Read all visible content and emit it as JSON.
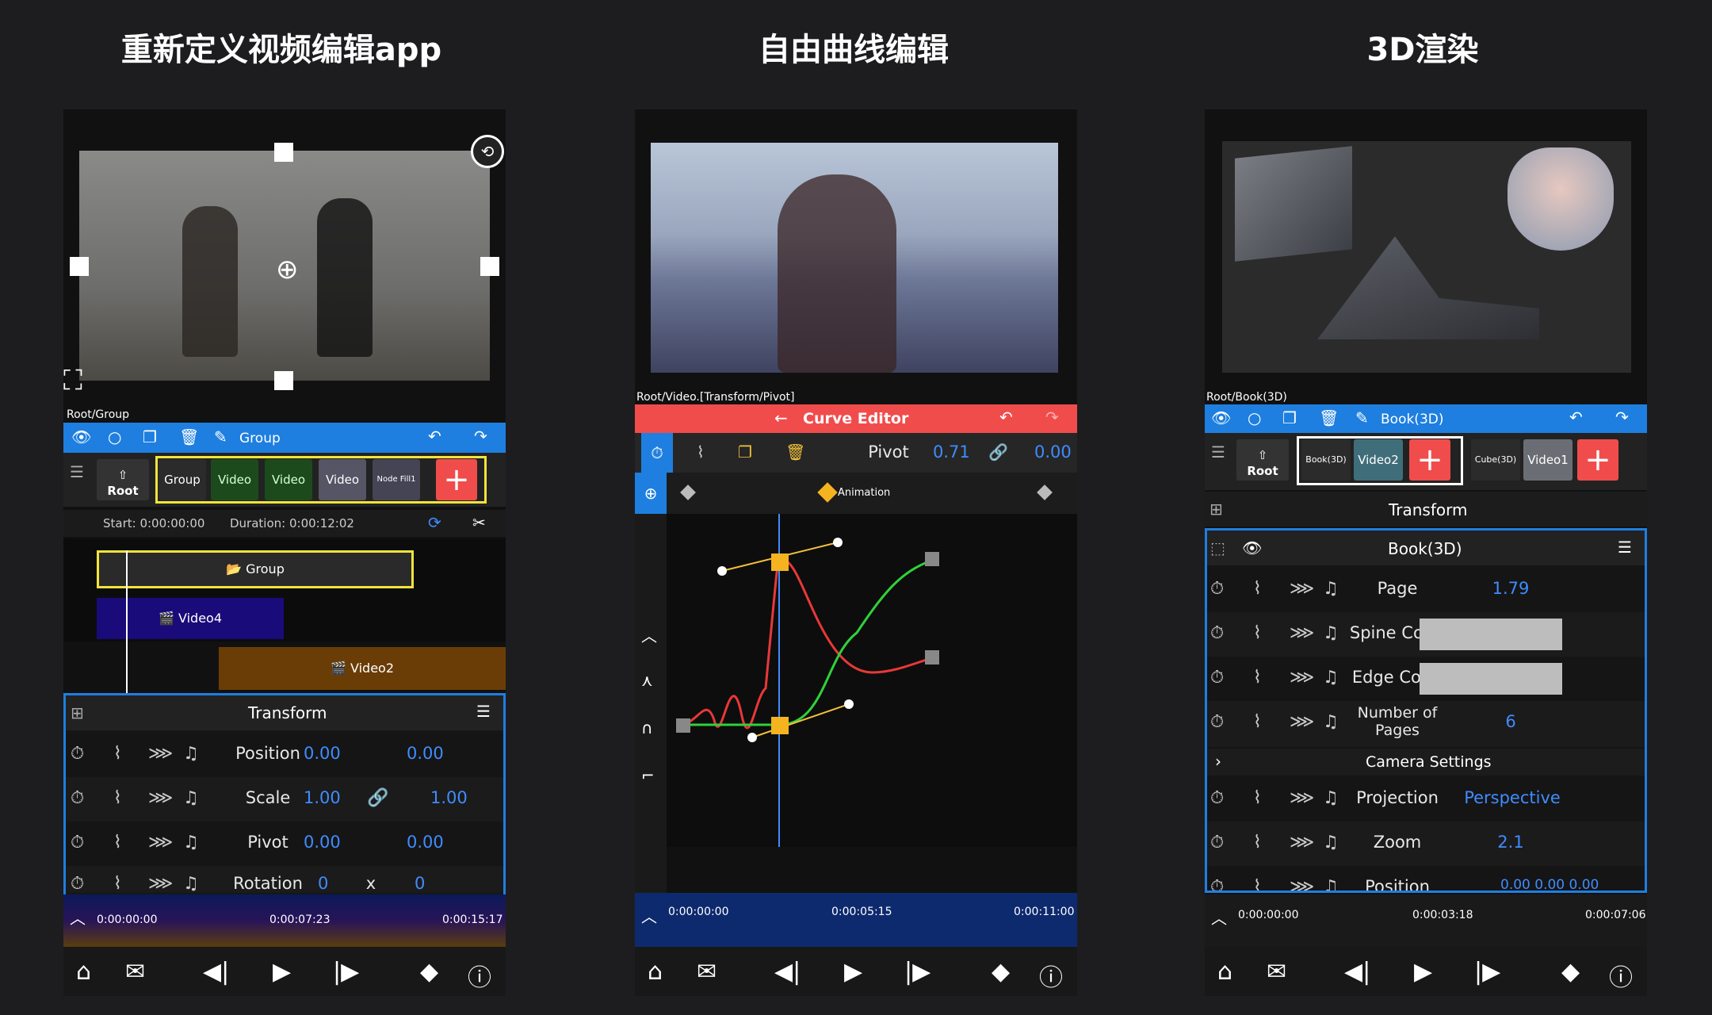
{
  "headlines": [
    "重新定义视频编辑app",
    "自由曲线编辑",
    "3D渲染"
  ],
  "phone1": {
    "breadcrumb": "Root/Group",
    "topbar": {
      "title": "Group"
    },
    "root_label": "Root",
    "chips": [
      "Group",
      "Video",
      "Video",
      "Video",
      "Node Fill1"
    ],
    "start": "Start: 0:00:00:00",
    "duration": "Duration: 0:00:12:02",
    "tracks": [
      "Group",
      "Video4",
      "Video2"
    ],
    "panel_title": "Transform",
    "props": [
      {
        "name": "Position",
        "v1": "0.00",
        "v2": "0.00"
      },
      {
        "name": "Scale",
        "v1": "1.00",
        "v2": "1.00"
      },
      {
        "name": "Pivot",
        "v1": "0.00",
        "v2": "0.00"
      },
      {
        "name": "Rotation",
        "v1": "0",
        "mid": "x",
        "v2": "0"
      }
    ],
    "timecodes": [
      "0:00:00:00",
      "0:00:07:23",
      "0:00:15:17"
    ]
  },
  "phone2": {
    "breadcrumb": "Root/Video.[Transform/Pivot]",
    "title": "Curve Editor",
    "param": "Pivot",
    "v1": "0.71",
    "v2": "0.00",
    "keyframe_label": "Animation",
    "timecodes": [
      "0:00:00:00",
      "0:00:05:15",
      "0:00:11:00"
    ]
  },
  "phone3": {
    "breadcrumb": "Root/Book(3D)",
    "topbar": {
      "title": "Book(3D)"
    },
    "root_label": "Root",
    "chips": [
      "Book(3D)",
      "Video2",
      "Cube(3D)",
      "Video1"
    ],
    "section_title": "Transform",
    "node_title": "Book(3D)",
    "props": [
      {
        "name": "Page",
        "value": "1.79"
      },
      {
        "name": "Spine Color",
        "value": ""
      },
      {
        "name": "Edge Color",
        "value": ""
      },
      {
        "name": "Number of Pages",
        "value": "6"
      }
    ],
    "camera": "Camera Settings",
    "props2": [
      {
        "name": "Projection",
        "value": "Perspective"
      },
      {
        "name": "Zoom",
        "value": "2.1"
      },
      {
        "name": "Position",
        "value": "0.00   0.00   0.00"
      }
    ],
    "timecodes": [
      "0:00:00:00",
      "0:00:03:18",
      "0:00:07:06"
    ]
  },
  "colors": {
    "accent_blue": "#1e7fe0",
    "accent_red": "#f04c4c",
    "value_blue": "#3f8cff",
    "highlight_yellow": "#f2e43a"
  }
}
